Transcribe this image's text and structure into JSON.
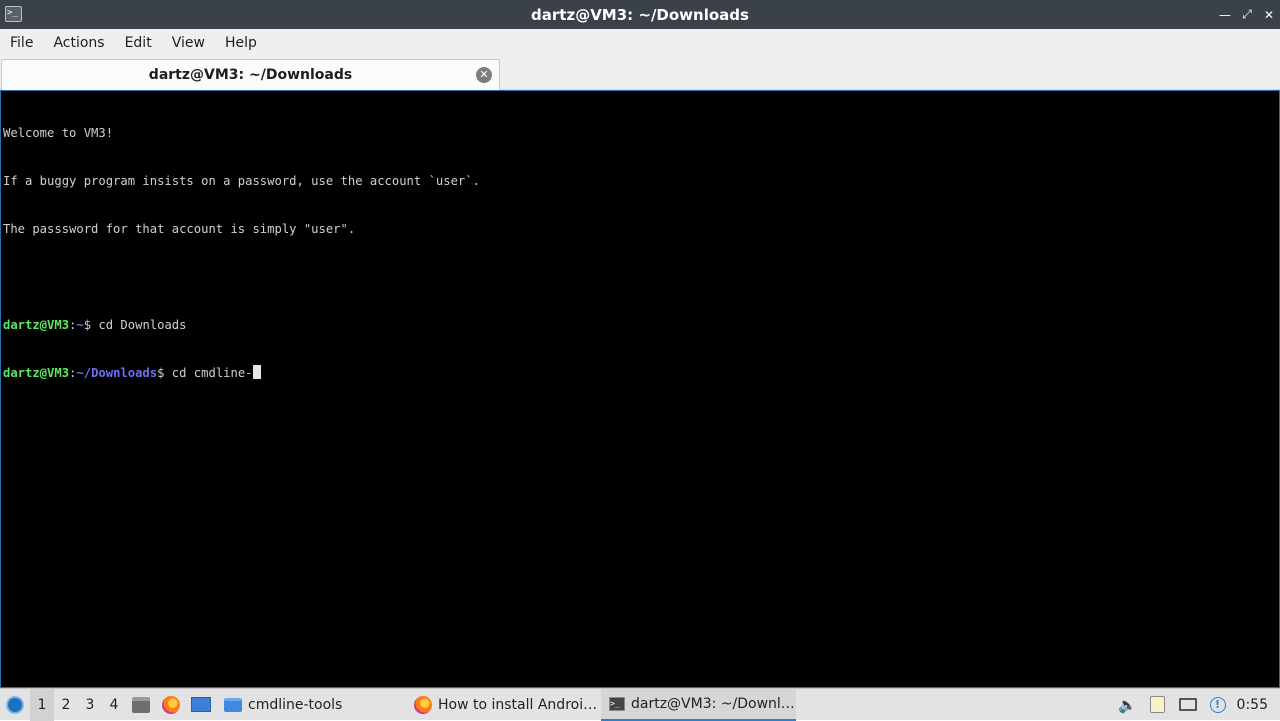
{
  "window": {
    "title": "dartz@VM3: ~/Downloads",
    "app_icon": "terminal-icon"
  },
  "menu": [
    "File",
    "Actions",
    "Edit",
    "View",
    "Help"
  ],
  "tab": {
    "label": "dartz@VM3: ~/Downloads"
  },
  "terminal": {
    "welcome_lines": [
      "Welcome to VM3!",
      "If a buggy program insists on a password, use the account `user`.",
      "The passsword for that account is simply \"user\"."
    ],
    "history": [
      {
        "user_host": "dartz@VM3",
        "path": "~",
        "command": "cd Downloads"
      },
      {
        "user_host": "dartz@VM3",
        "path": "~/Downloads",
        "command": "cd cmdline-"
      }
    ]
  },
  "taskbar": {
    "workspaces": [
      "1",
      "2",
      "3",
      "4"
    ],
    "active_workspace": "1",
    "tasks": [
      {
        "label": "cmdline-tools",
        "icon": "folder-icon"
      },
      {
        "label": "How to install Androi…",
        "icon": "firefox-icon"
      },
      {
        "label": "dartz@VM3: ~/Downl…",
        "icon": "terminal-icon"
      }
    ],
    "clock": "0:55",
    "notification_count": "!"
  }
}
